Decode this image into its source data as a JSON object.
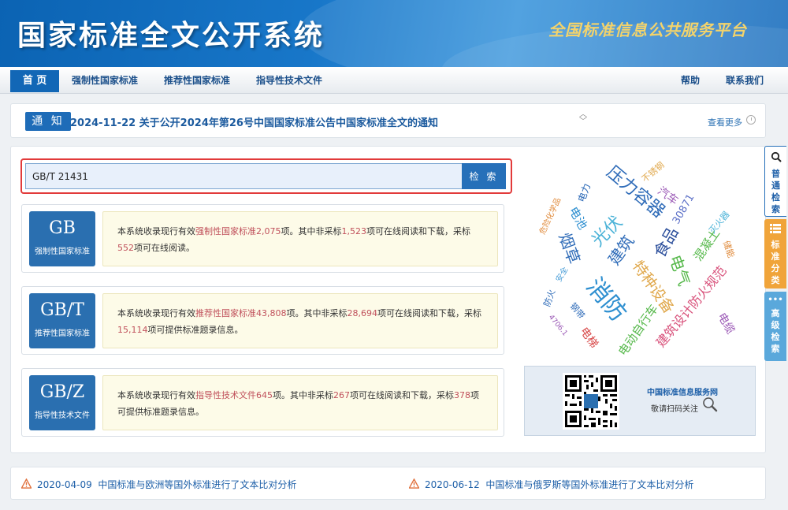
{
  "header": {
    "site_title": "国家标准全文公开系统",
    "slogan": "全国标准信息公共服务平台"
  },
  "nav": {
    "home": "首 页",
    "mandatory": "强制性国家标准",
    "recommended": "推荐性国家标准",
    "guidance": "指导性技术文件",
    "help": "帮助",
    "contact": "联系我们"
  },
  "notice": {
    "badge": "通 知",
    "text": "2024-11-22  关于公开2024年第26号中国国家标准公告中国家标准全文的通知",
    "arrow_up": "︿",
    "arrow_down": "﹀",
    "more": "查看更多"
  },
  "search": {
    "value": "GB/T 21431",
    "button": "检 索"
  },
  "categories": [
    {
      "code": "GB",
      "name": "强制性国家标准",
      "d1": "本系统收录现行有效",
      "link": "强制性国家标准",
      "total": "2,075",
      "d2": "项。其中非采标",
      "nonadopted": "1,523",
      "d3": "项可在线阅读和下载，采标",
      "adopted": "552",
      "d4": "项可在线阅读。"
    },
    {
      "code": "GB/T",
      "name": "推荐性国家标准",
      "d1": "本系统收录现行有效",
      "link": "推荐性国家标准",
      "total": "43,808",
      "d2": "项。其中非采标",
      "nonadopted": "28,694",
      "d3": "项可在线阅读和下载，采标",
      "adopted": "15,114",
      "d4": "项可提供标准题录信息。"
    },
    {
      "code": "GB/Z",
      "name": "指导性技术文件",
      "d1": "本系统收录现行有效",
      "link": "指导性技术文件",
      "total": "645",
      "d2": "项。其中非采标",
      "nonadopted": "267",
      "d3": "项可在线阅读和下载，采标",
      "adopted": "378",
      "d4": "项可提供标准题录信息。"
    }
  ],
  "word_cloud": [
    {
      "text": "压力容器",
      "color": "#2e6bb8"
    },
    {
      "text": "汽车",
      "color": "#9b59b6"
    },
    {
      "text": "不锈钢",
      "color": "#e0a84c"
    },
    {
      "text": "30871",
      "color": "#5b6fc7"
    },
    {
      "text": "电力",
      "color": "#2e6bb8"
    },
    {
      "text": "危险化学品",
      "color": "#e08b3c"
    },
    {
      "text": "电池",
      "color": "#2e8fd0"
    },
    {
      "text": "光伏",
      "color": "#4cb3d8"
    },
    {
      "text": "建筑",
      "color": "#2e6bb8"
    },
    {
      "text": "食品",
      "color": "#2b4e9b"
    },
    {
      "text": "混凝土",
      "color": "#55b84a"
    },
    {
      "text": "灭火器",
      "color": "#4cb3d8"
    },
    {
      "text": "储能",
      "color": "#e08b3c"
    },
    {
      "text": "烟草",
      "color": "#2e6bb8"
    },
    {
      "text": "电气",
      "color": "#55b84a"
    },
    {
      "text": "特种设备",
      "color": "#e0a84c"
    },
    {
      "text": "安全",
      "color": "#4c9fd8"
    },
    {
      "text": "消防",
      "color": "#2e8fd0"
    },
    {
      "text": "防火",
      "color": "#2e6bb8"
    },
    {
      "text": "钢带",
      "color": "#2e6bb8"
    },
    {
      "text": "建筑设计防火规范",
      "color": "#d8507a"
    },
    {
      "text": "4706.1",
      "color": "#9b59b6"
    },
    {
      "text": "电梯",
      "color": "#d84a4a"
    },
    {
      "text": "电动自行车",
      "color": "#55b84a"
    },
    {
      "text": "电缆",
      "color": "#9b59b6"
    }
  ],
  "qr": {
    "title": "中国标准信息服务网",
    "subtitle": "敬请扫码关注"
  },
  "side_tabs": {
    "normal": "普通检索",
    "classification": "标准分类",
    "advanced": "高级检索"
  },
  "news": [
    {
      "date": "2020-04-09",
      "title": "中国标准与欧洲等国外标准进行了文本比对分析"
    },
    {
      "date": "2020-06-12",
      "title": "中国标准与俄罗斯等国外标准进行了文本比对分析"
    }
  ]
}
